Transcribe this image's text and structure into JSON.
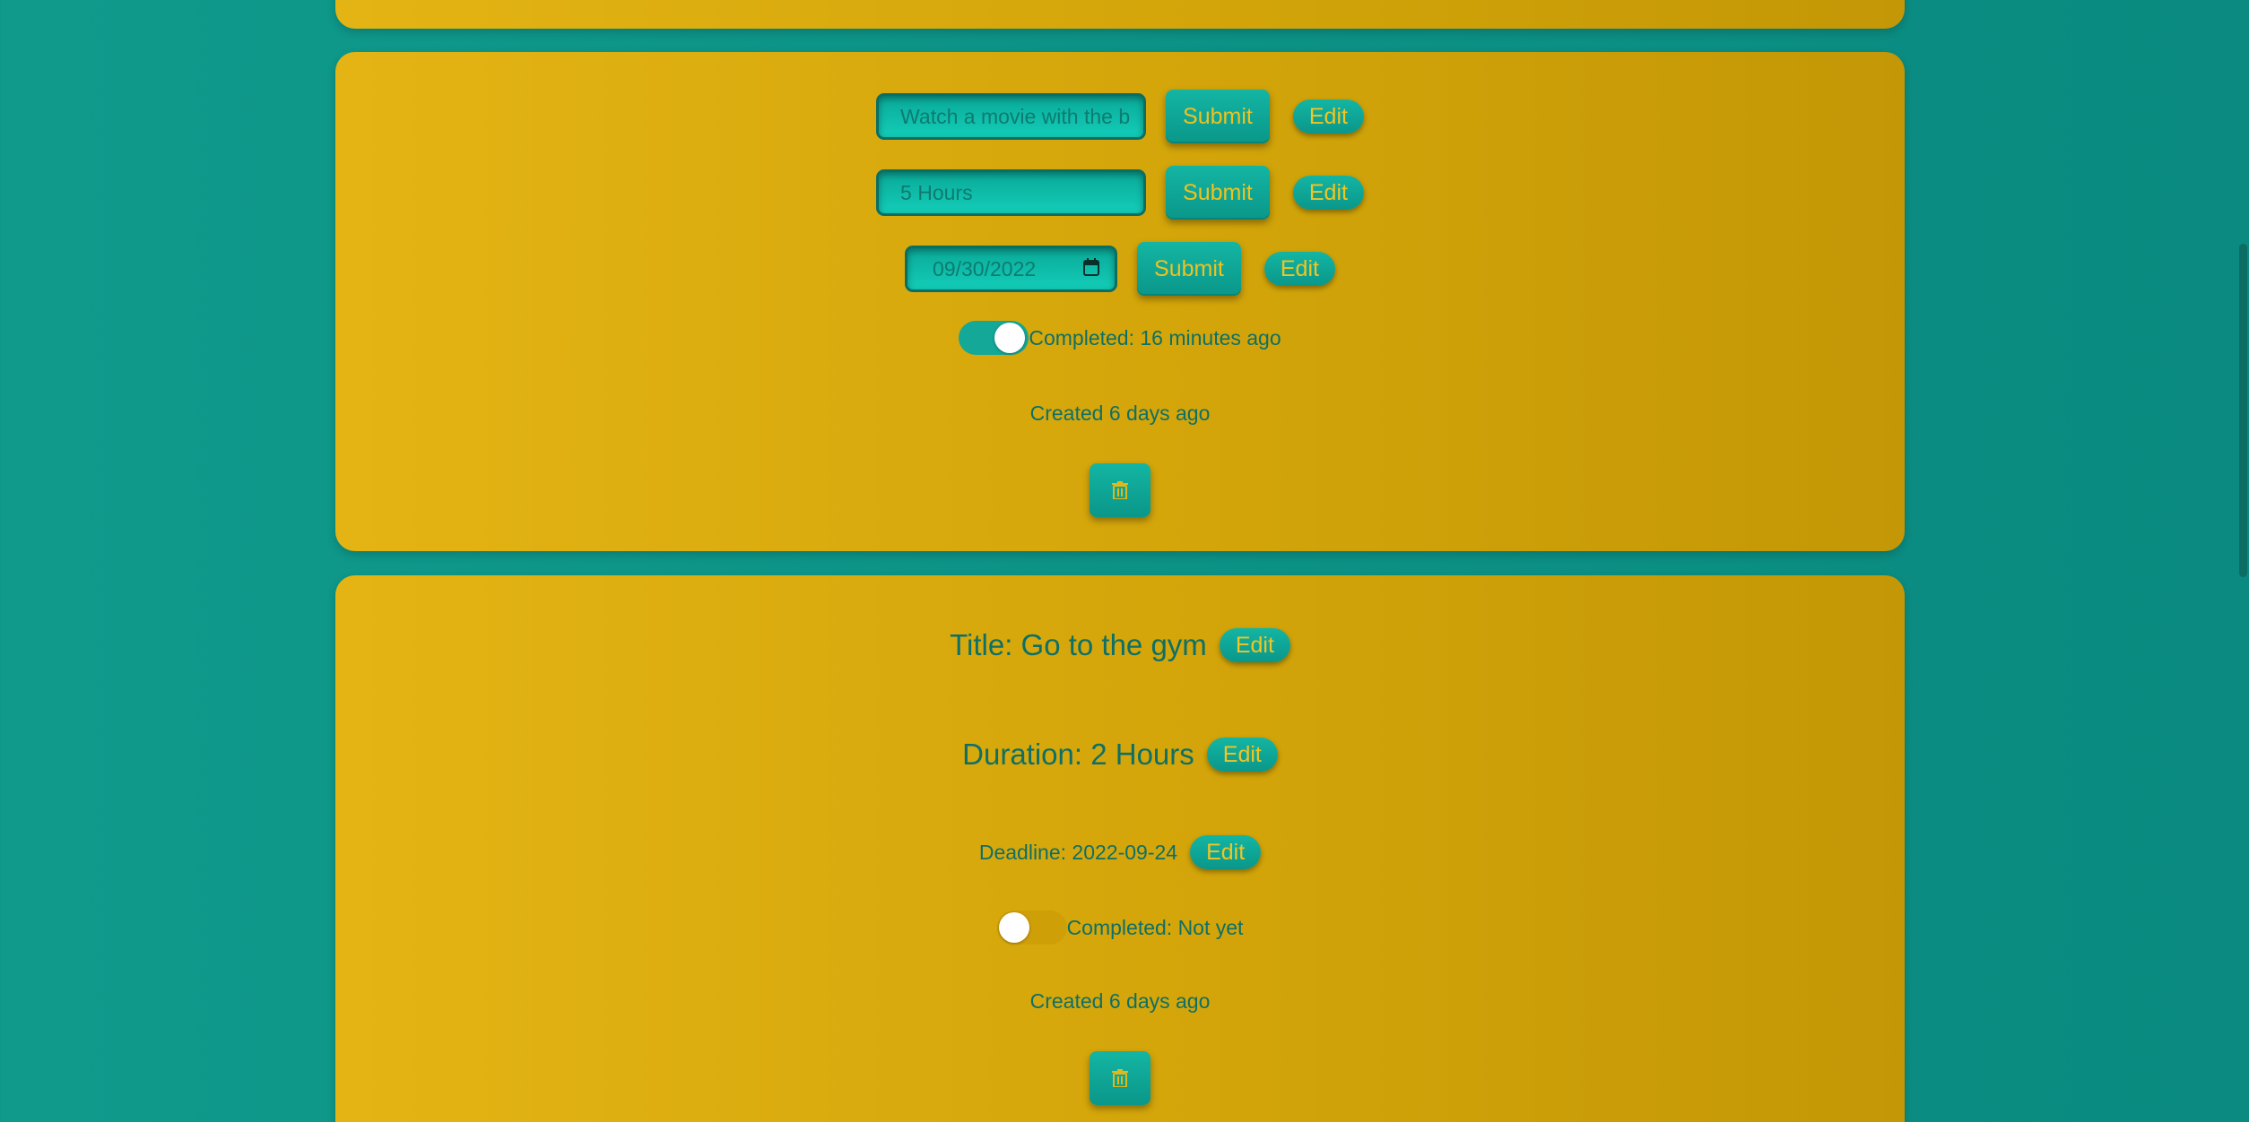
{
  "card_a": {
    "title_input": {
      "placeholder": "Watch a movie with the bo"
    },
    "duration_input": {
      "placeholder": "5 Hours"
    },
    "deadline_input": {
      "placeholder": "09/30/2022"
    },
    "submit_label": "Submit",
    "edit_label": "Edit",
    "completed": {
      "on": true,
      "text": "Completed: 16 minutes ago"
    },
    "created": "Created 6 days ago",
    "delete_icon": "trash-icon"
  },
  "card_b": {
    "title": "Title: Go to the gym",
    "duration": "Duration: 2 Hours",
    "deadline": "Deadline: 2022-09-24",
    "edit_label": "Edit",
    "completed": {
      "on": false,
      "text": "Completed: Not yet"
    },
    "created": "Created 6 days ago",
    "delete_icon": "trash-icon"
  },
  "colors": {
    "background": "#0f9a8c",
    "card": "#e4b414",
    "accent": "#13a898",
    "button_text": "#f0c21e"
  }
}
